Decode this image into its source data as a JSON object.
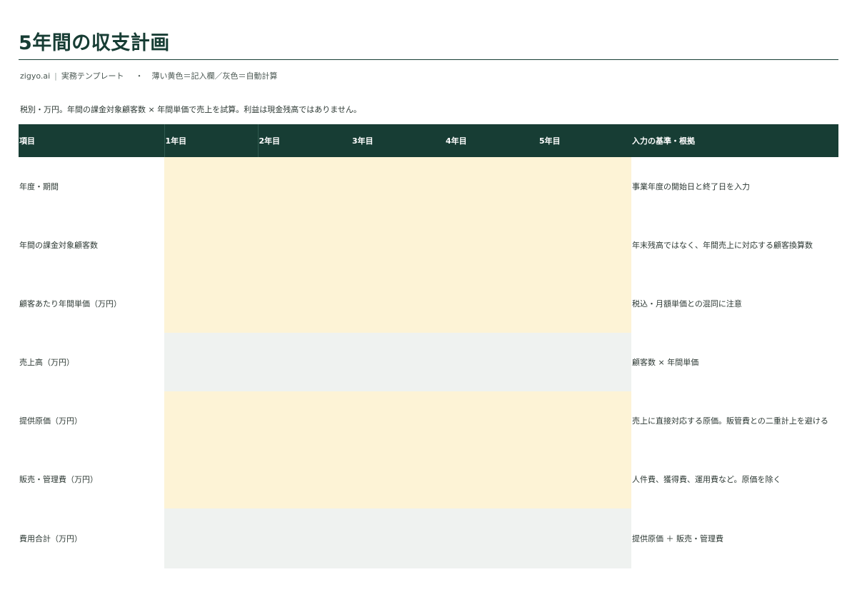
{
  "header": {
    "title": "5年間の収支計画",
    "brand": "zigyo.ai",
    "template_label": "実務テンプレート",
    "dot": "・",
    "legend": "薄い黄色＝記入欄／灰色＝自動計算"
  },
  "note": "税別・万円。年間の課金対象顧客数 × 年間単価で売上を試算。利益は現金残高ではありません。",
  "table": {
    "headers": {
      "item": "項目",
      "y1": "1年目",
      "y2": "2年目",
      "y3": "3年目",
      "y4": "4年目",
      "y5": "5年目",
      "basis": "入力の基準・根拠"
    },
    "rows": [
      {
        "label": "年度・期間",
        "basis": "事業年度の開始日と終了日を入力",
        "kind": "input"
      },
      {
        "label": "年間の課金対象顧客数",
        "basis": "年末残高ではなく、年間売上に対応する顧客換算数",
        "kind": "input"
      },
      {
        "label": "顧客あたり年間単価（万円）",
        "basis": "税込・月額単価との混同に注意",
        "kind": "input"
      },
      {
        "label": "売上高（万円）",
        "basis": "顧客数 × 年間単価",
        "kind": "calc"
      },
      {
        "label": "提供原価（万円）",
        "basis": "売上に直接対応する原価。販管費との二重計上を避ける",
        "kind": "input"
      },
      {
        "label": "販売・管理費（万円）",
        "basis": "人件費、獲得費、運用費など。原価を除く",
        "kind": "input"
      },
      {
        "label": "費用合計（万円）",
        "basis": "提供原価 ＋ 販売・管理費",
        "kind": "calc"
      }
    ]
  },
  "colors": {
    "header_bg": "#173d34",
    "input_fill": "#fdf3d6",
    "calc_fill": "#eff2f0"
  }
}
